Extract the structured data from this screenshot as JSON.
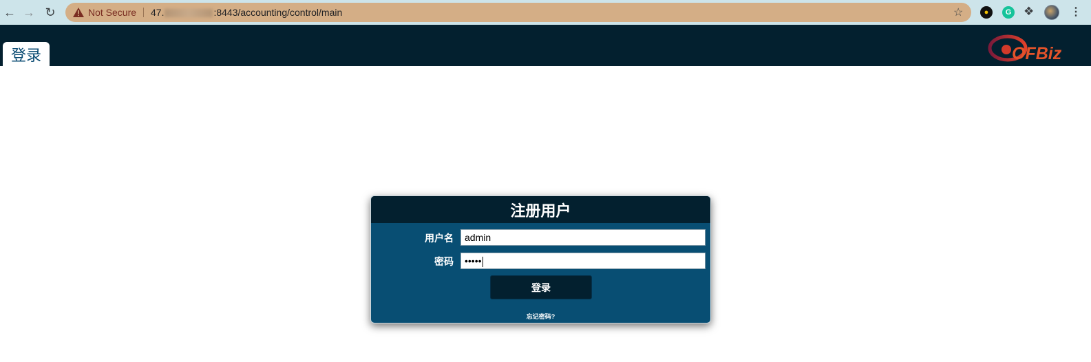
{
  "browser": {
    "security_label": "Not Secure",
    "url_prefix": "47.",
    "url_suffix": ":8443/accounting/control/main"
  },
  "header": {
    "tab_label": "登录",
    "logo_text": "OFBiz"
  },
  "login": {
    "title": "注册用户",
    "username_label": "用户名",
    "username_value": "admin",
    "password_label": "密码",
    "password_masked": "•••••",
    "submit_label": "登录",
    "forgot_label": "忘记密码?"
  },
  "colors": {
    "header_bg": "#03202f",
    "box_bg": "#084e73",
    "omnibox_bg": "#d4ae86"
  }
}
